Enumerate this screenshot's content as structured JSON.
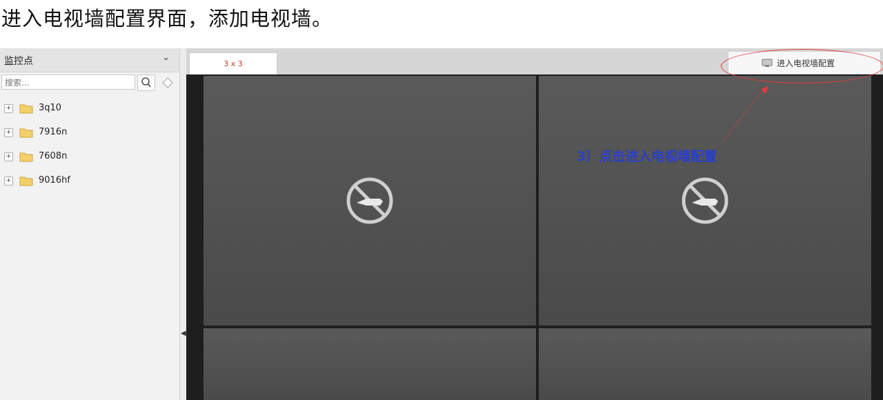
{
  "caption": "进入电视墙配置界面，添加电视墙。",
  "sidebar": {
    "title": "监控点",
    "search_placeholder": "搜索...",
    "items": [
      {
        "label": "3q10"
      },
      {
        "label": "7916n"
      },
      {
        "label": "7608n"
      },
      {
        "label": "9016hf"
      }
    ]
  },
  "tabs": [
    {
      "label": "3 x 3"
    }
  ],
  "toolbar": {
    "enter_tv_wall_label": "进入电视墙配置"
  },
  "annotation": "3）点击进入电视墙配置",
  "colors": {
    "annotation": "#2a3ecc",
    "highlight": "#e23b3b",
    "tab_text": "#c0392b"
  },
  "icons": {
    "no_signal": "no-signal-icon",
    "folder": "folder-icon",
    "search": "search-icon"
  }
}
